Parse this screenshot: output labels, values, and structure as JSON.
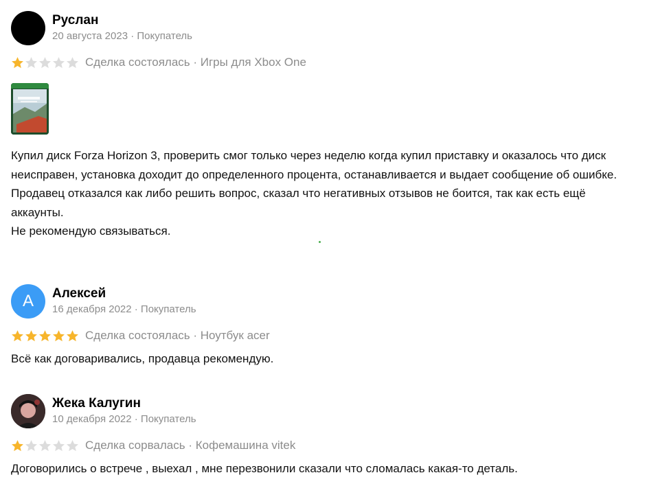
{
  "colors": {
    "star_filled": "#f7b52b",
    "star_empty": "#dcdcdc",
    "meta_gray": "#8c8c8c",
    "avatar_blue": "#3b9cf6"
  },
  "reviews": [
    {
      "author": "Руслан",
      "meta": "20 августа 2023 · Покупатель",
      "rating": 1,
      "deal": "Сделка состоялась · Игры для Xbox One",
      "avatar_type": "black",
      "avatar_letter": "",
      "has_photo": true,
      "photo_icon": "forza-horizon-3-cover-image",
      "text": [
        "Купил диск Forza Horizon 3, проверить смог только через неделю когда купил приставку и оказалось что диск неисправен, установка доходит до определенного процента, останавливается и выдает сообщение об ошибке.",
        "Продавец отказался как либо решить вопрос, сказал что негативных отзывов не боится, так как есть ещё аккаунты.",
        "Не рекомендую связываться."
      ]
    },
    {
      "author": "Алексей",
      "meta": "16 декабря 2022 · Покупатель",
      "rating": 5,
      "deal": "Сделка состоялась · Ноутбук acer",
      "avatar_type": "letter",
      "avatar_letter": "А",
      "has_photo": false,
      "text": [
        "Всё как договаривались, продавца рекомендую."
      ]
    },
    {
      "author": "Жека Калугин",
      "meta": "10 декабря 2022 · Покупатель",
      "rating": 1,
      "deal": "Сделка сорвалась · Кофемашина vitek",
      "avatar_type": "photo",
      "avatar_letter": "",
      "has_photo": false,
      "text": [
        "Договорились о встрече , выехал , мне перезвонили сказали что сломалась какая-то деталь."
      ]
    }
  ]
}
